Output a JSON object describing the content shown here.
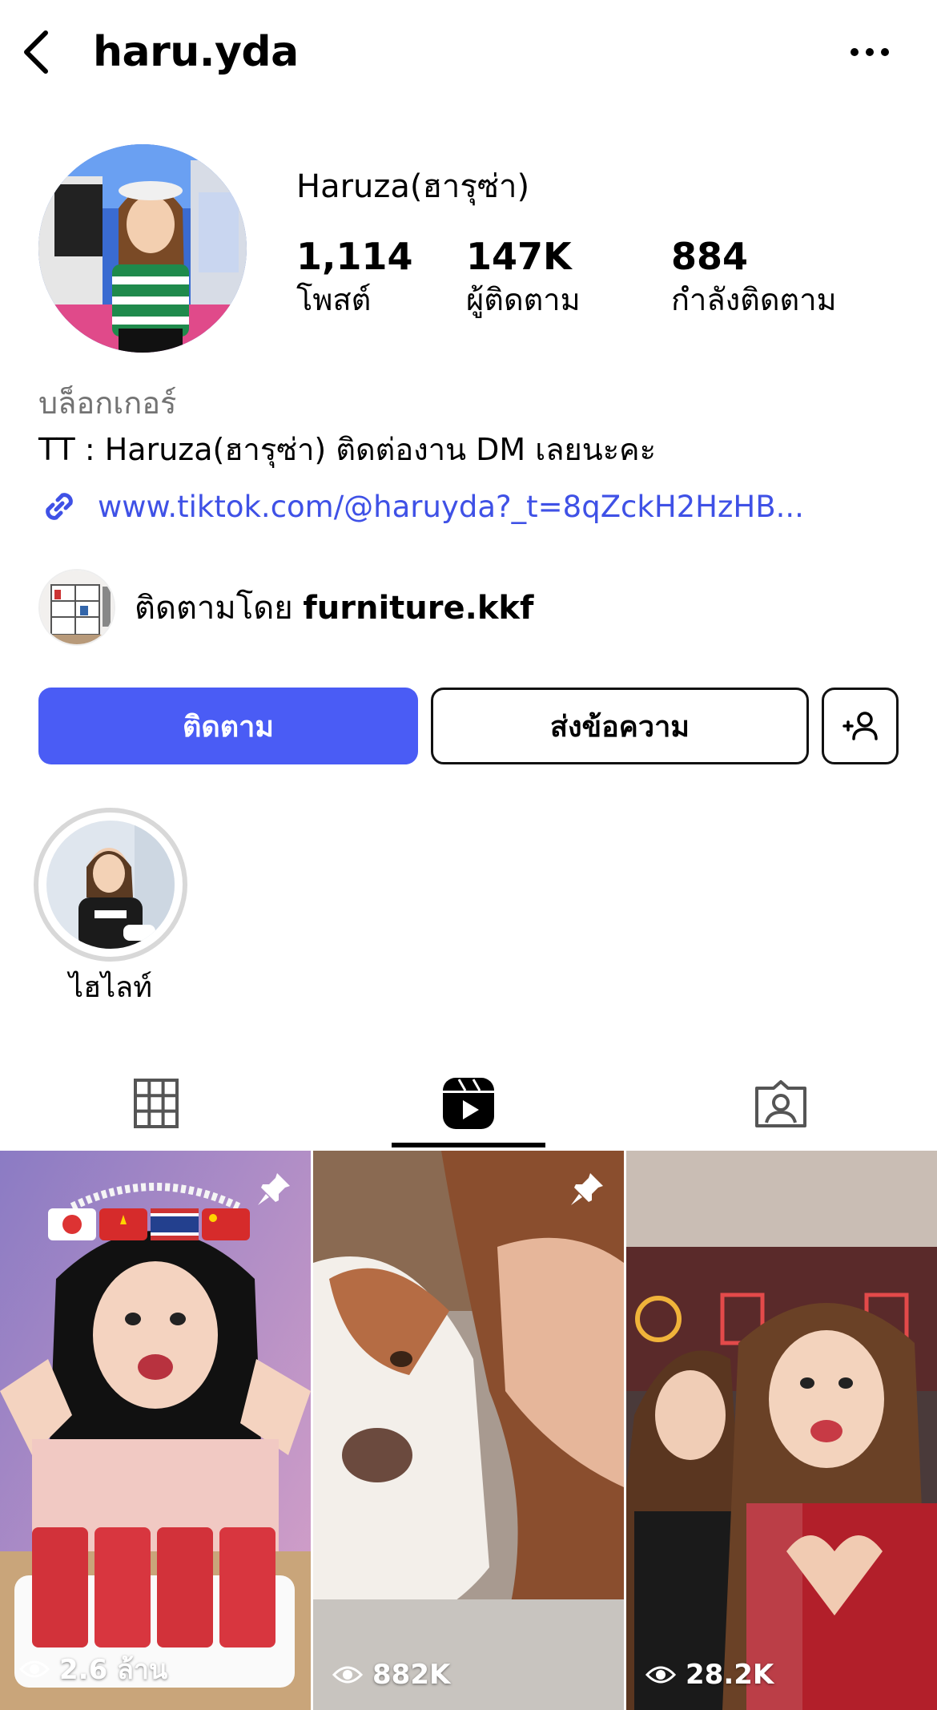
{
  "header": {
    "username": "haru.yda",
    "back_icon": "chevron-left-icon",
    "more_icon": "more-horizontal-icon"
  },
  "profile": {
    "display_name": "Haruza(ฮารุซ่า)",
    "stats": {
      "posts": {
        "value": "1,114",
        "label": "โพสต์"
      },
      "followers": {
        "value": "147K",
        "label": "ผู้ติดตาม"
      },
      "following": {
        "value": "884",
        "label": "กำลังติดตาม"
      }
    },
    "category": "บล็อกเกอร์",
    "bio": "TT : Haruza(ฮารุซ่า) ติดต่องาน DM เลยนะคะ",
    "link": "www.tiktok.com/@haruyda?_t=8qZckH2HzHB...",
    "followed_by": {
      "prefix": "ติดตามโดย",
      "name": "furniture.kkf"
    }
  },
  "actions": {
    "follow_label": "ติดตาม",
    "message_label": "ส่งข้อความ",
    "add_user_icon": "add-user-icon"
  },
  "highlights": [
    {
      "label": "ไฮไลท์"
    }
  ],
  "tabs": [
    {
      "icon": "grid-icon",
      "active": false
    },
    {
      "icon": "reels-icon",
      "active": true
    },
    {
      "icon": "tagged-icon",
      "active": false
    }
  ],
  "reels": [
    {
      "views": "2.6 ล้าน",
      "pinned": true
    },
    {
      "views": "882K",
      "pinned": true
    },
    {
      "views": "28.2K",
      "pinned": false
    }
  ],
  "colors": {
    "accent": "#4a5cf5",
    "link": "#3f51e6",
    "muted": "#737373"
  }
}
